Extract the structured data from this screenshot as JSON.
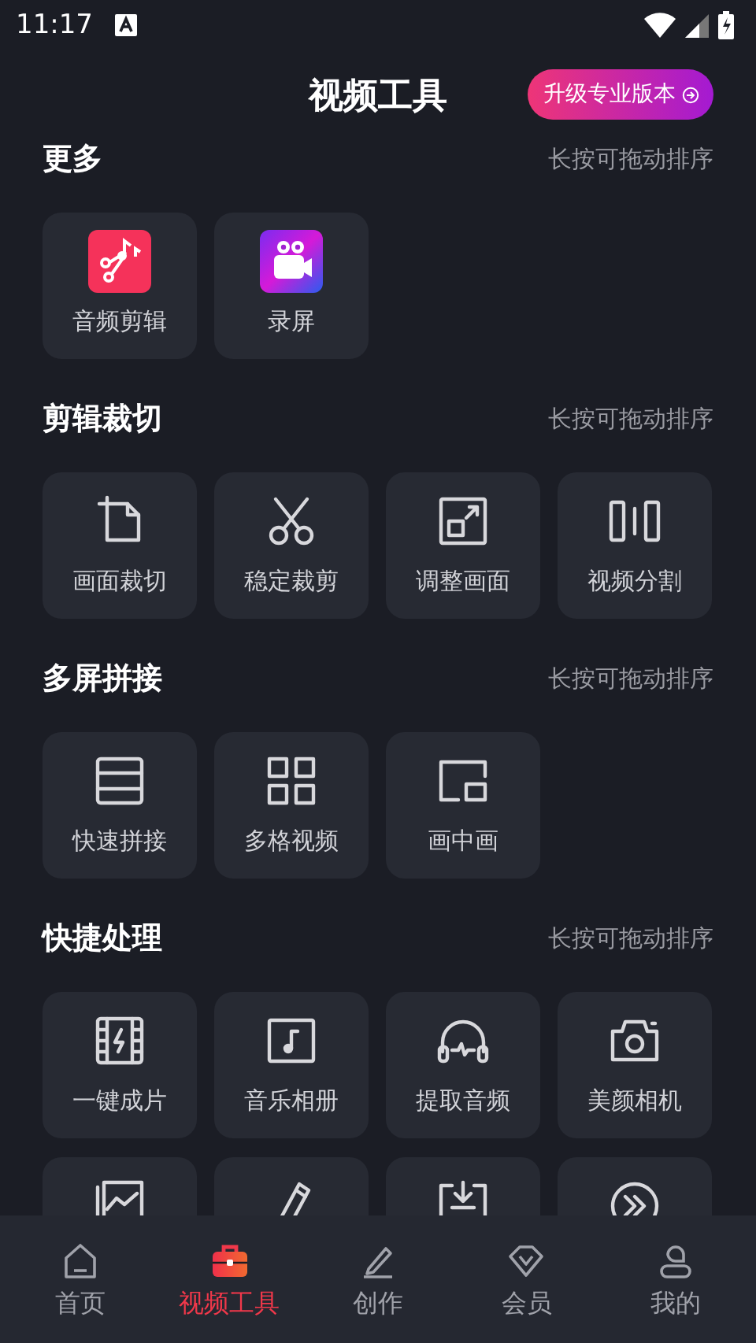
{
  "status_bar": {
    "time": "11:17"
  },
  "header": {
    "title": "视频工具",
    "upgrade_button": "升级专业版本"
  },
  "sections": [
    {
      "title": "更多",
      "hint": "长按可拖动排序",
      "items": [
        {
          "kind": "tool",
          "label": "音频剪辑"
        },
        {
          "kind": "tool",
          "label": "录屏"
        }
      ]
    },
    {
      "title": "剪辑裁切",
      "hint": "长按可拖动排序",
      "items": [
        {
          "kind": "tool",
          "label": "画面裁切"
        },
        {
          "kind": "tool",
          "label": "稳定裁剪"
        },
        {
          "kind": "tool",
          "label": "调整画面"
        },
        {
          "kind": "tool",
          "label": "视频分割"
        }
      ]
    },
    {
      "title": "多屏拼接",
      "hint": "长按可拖动排序",
      "items": [
        {
          "kind": "tool",
          "label": "快速拼接"
        },
        {
          "kind": "tool",
          "label": "多格视频"
        },
        {
          "kind": "tool",
          "label": "画中画"
        }
      ]
    },
    {
      "title": "快捷处理",
      "hint": "长按可拖动排序",
      "items": [
        {
          "kind": "tool",
          "label": "一键成片"
        },
        {
          "kind": "tool",
          "label": "音乐相册"
        },
        {
          "kind": "tool",
          "label": "提取音频"
        },
        {
          "kind": "tool",
          "label": "美颜相机"
        },
        {
          "kind": "partial"
        },
        {
          "kind": "partial"
        },
        {
          "kind": "partial"
        },
        {
          "kind": "partial"
        }
      ]
    }
  ],
  "bottom_nav": [
    {
      "label": "首页",
      "selected": false
    },
    {
      "label": "视频工具",
      "selected": true
    },
    {
      "label": "创作",
      "selected": false
    },
    {
      "label": "会员",
      "selected": false
    },
    {
      "label": "我的",
      "selected": false
    }
  ]
}
